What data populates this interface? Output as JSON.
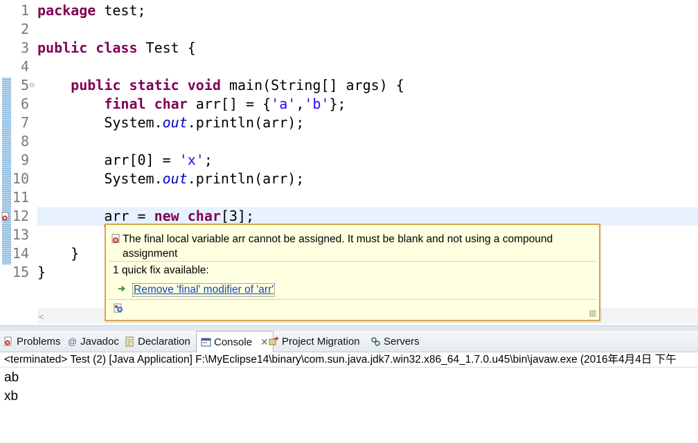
{
  "editor": {
    "lines": [
      {
        "n": "1",
        "tokens": [
          {
            "t": "package",
            "c": "kw"
          },
          {
            "t": " test;"
          }
        ]
      },
      {
        "n": "2",
        "tokens": []
      },
      {
        "n": "3",
        "tokens": [
          {
            "t": "public",
            "c": "kw"
          },
          {
            "t": " "
          },
          {
            "t": "class",
            "c": "kw"
          },
          {
            "t": " Test {"
          }
        ]
      },
      {
        "n": "4",
        "tokens": []
      },
      {
        "n": "5",
        "tokens": [
          {
            "t": "    "
          },
          {
            "t": "public",
            "c": "kw"
          },
          {
            "t": " "
          },
          {
            "t": "static",
            "c": "kw"
          },
          {
            "t": " "
          },
          {
            "t": "void",
            "c": "kw"
          },
          {
            "t": " main(String[] args) {"
          }
        ]
      },
      {
        "n": "6",
        "tokens": [
          {
            "t": "        "
          },
          {
            "t": "final",
            "c": "kw"
          },
          {
            "t": " "
          },
          {
            "t": "char",
            "c": "kw"
          },
          {
            "t": " arr[] = {"
          },
          {
            "t": "'a'",
            "c": "str"
          },
          {
            "t": ","
          },
          {
            "t": "'b'",
            "c": "str"
          },
          {
            "t": "};"
          }
        ]
      },
      {
        "n": "7",
        "tokens": [
          {
            "t": "        System."
          },
          {
            "t": "out",
            "c": "fld"
          },
          {
            "t": ".println(arr);"
          }
        ]
      },
      {
        "n": "8",
        "tokens": []
      },
      {
        "n": "9",
        "tokens": [
          {
            "t": "        arr[0] = "
          },
          {
            "t": "'x'",
            "c": "str"
          },
          {
            "t": ";"
          }
        ]
      },
      {
        "n": "10",
        "tokens": [
          {
            "t": "        System."
          },
          {
            "t": "out",
            "c": "fld"
          },
          {
            "t": ".println(arr);"
          }
        ]
      },
      {
        "n": "11",
        "tokens": []
      },
      {
        "n": "12",
        "tokens": [
          {
            "t": "        "
          },
          {
            "t": "arr",
            "c": "err"
          },
          {
            "t": " = "
          },
          {
            "t": "new",
            "c": "kw"
          },
          {
            "t": " "
          },
          {
            "t": "char",
            "c": "kw"
          },
          {
            "t": "[3];"
          }
        ]
      },
      {
        "n": "13",
        "tokens": []
      },
      {
        "n": "14",
        "tokens": [
          {
            "t": "    }"
          }
        ]
      },
      {
        "n": "15",
        "tokens": [
          {
            "t": "}"
          }
        ]
      }
    ],
    "fold_marker": "⊖",
    "scroll_left_arrow": "<"
  },
  "quickfix": {
    "message": "The final local variable arr cannot be assigned. It must be blank and not using a compound assignment",
    "count_label": "1 quick fix available:",
    "fix_label": "Remove 'final' modifier of 'arr'"
  },
  "panel": {
    "tabs": [
      {
        "label": "Problems",
        "icon": "problems-icon"
      },
      {
        "label": "Javadoc",
        "icon": "javadoc-icon"
      },
      {
        "label": "Declaration",
        "icon": "declaration-icon"
      },
      {
        "label": "Console",
        "icon": "console-icon",
        "active": true
      },
      {
        "label": "Project Migration",
        "icon": "project-migration-icon"
      },
      {
        "label": "Servers",
        "icon": "servers-icon"
      }
    ],
    "close_glyph": "✕",
    "console_header": "<terminated> Test (2) [Java Application] F:\\MyEclipse14\\binary\\com.sun.java.jdk7.win32.x86_64_1.7.0.u45\\bin\\javaw.exe (2016年4月4日 下午",
    "output": [
      "ab",
      "xb"
    ]
  },
  "colors": {
    "keyword": "#7f0055",
    "string": "#2a00ff",
    "field": "#0000c0",
    "popup_bg": "#ffffe1",
    "popup_border": "#d8a848",
    "link": "#0b49b8"
  }
}
